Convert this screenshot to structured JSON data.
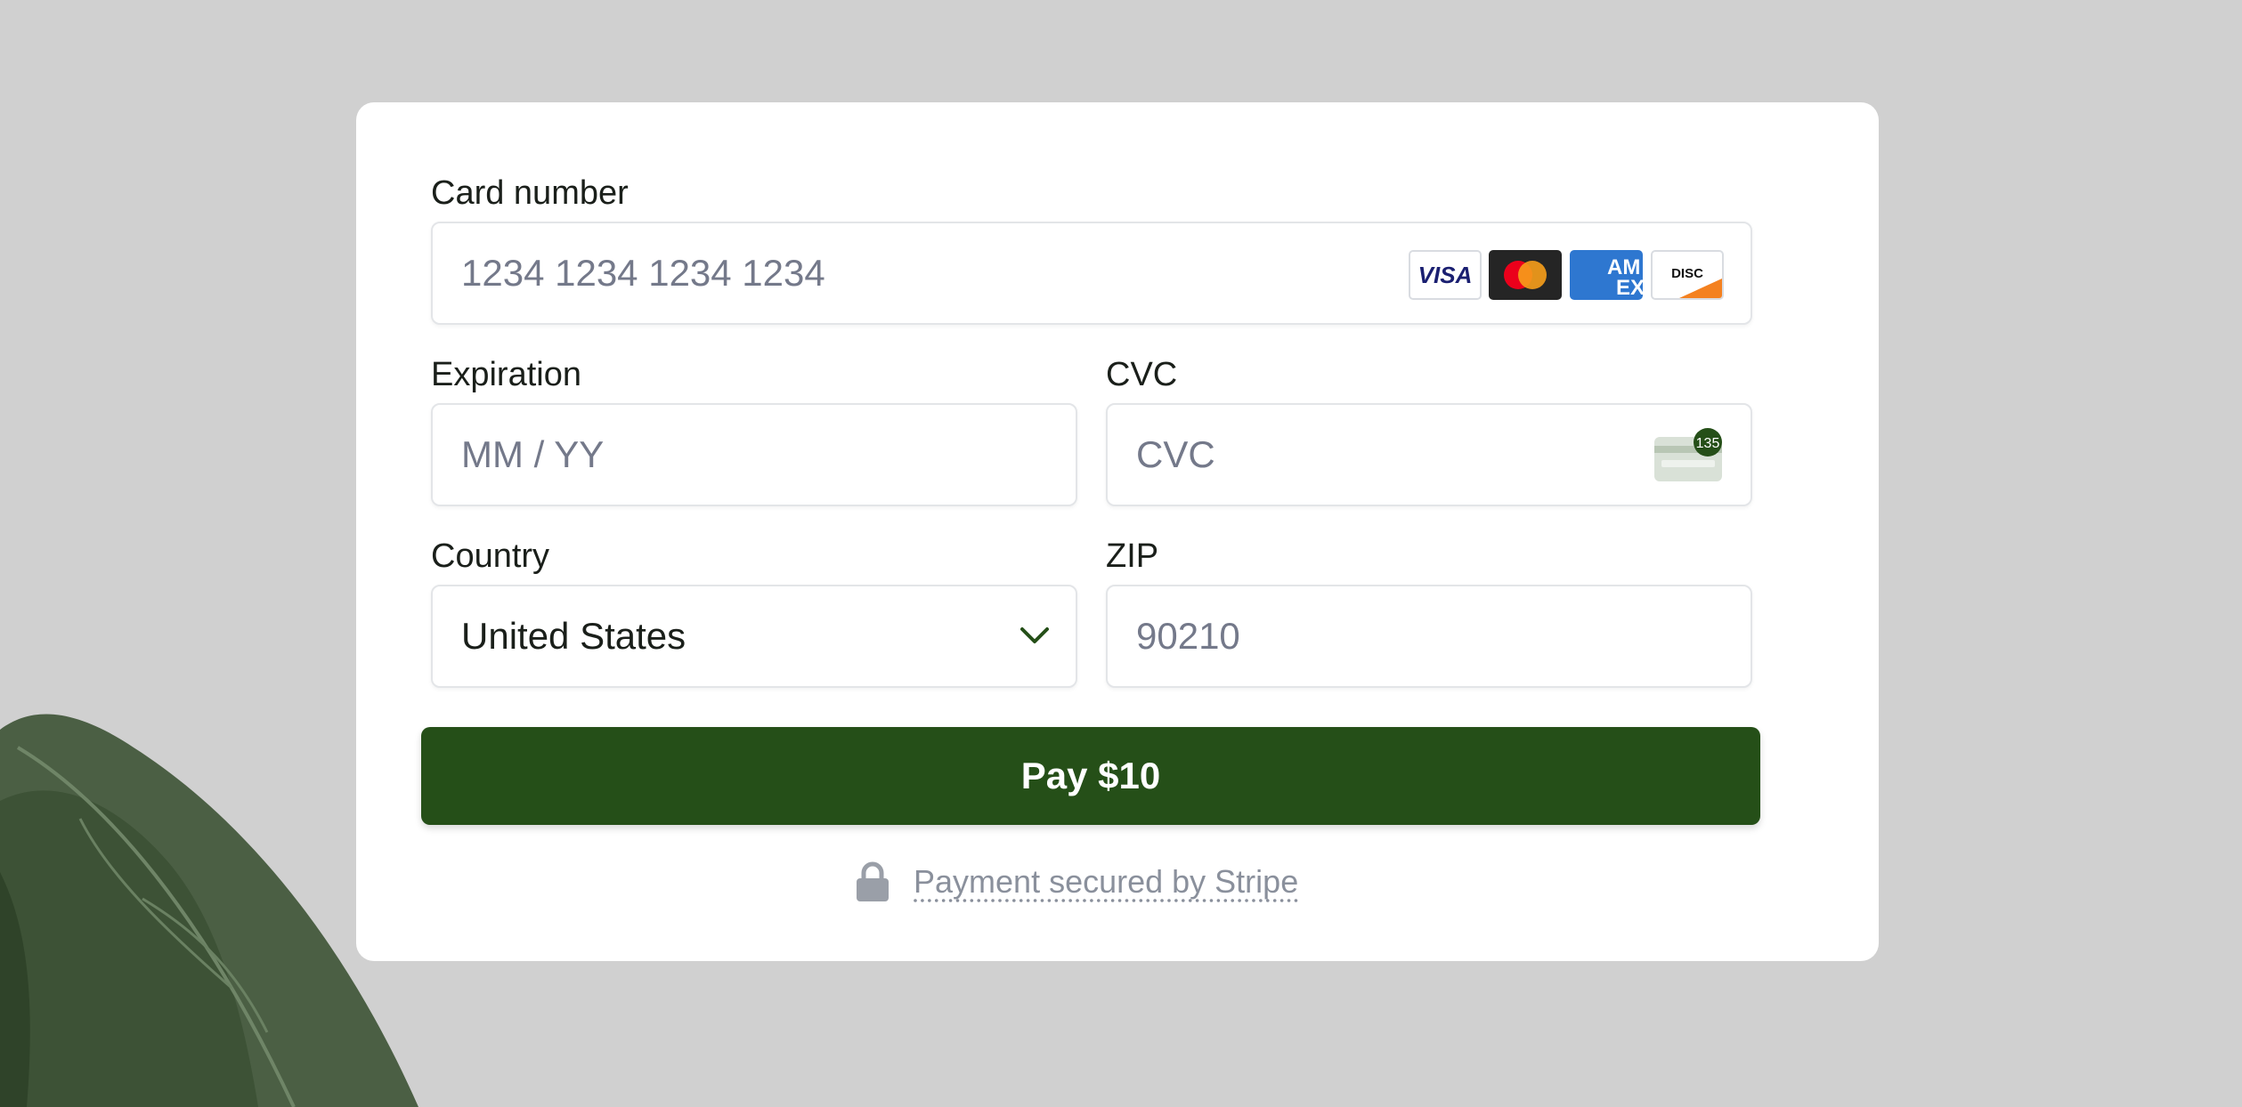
{
  "form": {
    "card_number": {
      "label": "Card number",
      "placeholder": "1234 1234 1234 1234",
      "value": ""
    },
    "card_brands": [
      {
        "name": "visa-icon",
        "text": "VISA",
        "color": "#1a1f71"
      },
      {
        "name": "mastercard-icon",
        "text": "",
        "color": "#252525"
      },
      {
        "name": "amex-icon",
        "text": "AM EX",
        "color": "#2e77d0"
      },
      {
        "name": "discover-icon",
        "text": "DISCOVER",
        "color": "#ffffff"
      }
    ],
    "expiration": {
      "label": "Expiration",
      "placeholder": "MM / YY",
      "value": ""
    },
    "cvc": {
      "label": "CVC",
      "placeholder": "CVC",
      "value": "",
      "icon_badge": "135"
    },
    "country": {
      "label": "Country",
      "selected": "United States"
    },
    "zip": {
      "label": "ZIP",
      "placeholder": "90210",
      "value": ""
    },
    "pay_button": {
      "label": "Pay $10"
    },
    "secured_text": "Payment secured by Stripe"
  },
  "colors": {
    "accent": "#254f18",
    "background": "#d0d0d0",
    "card": "#ffffff",
    "placeholder": "#74798a"
  }
}
